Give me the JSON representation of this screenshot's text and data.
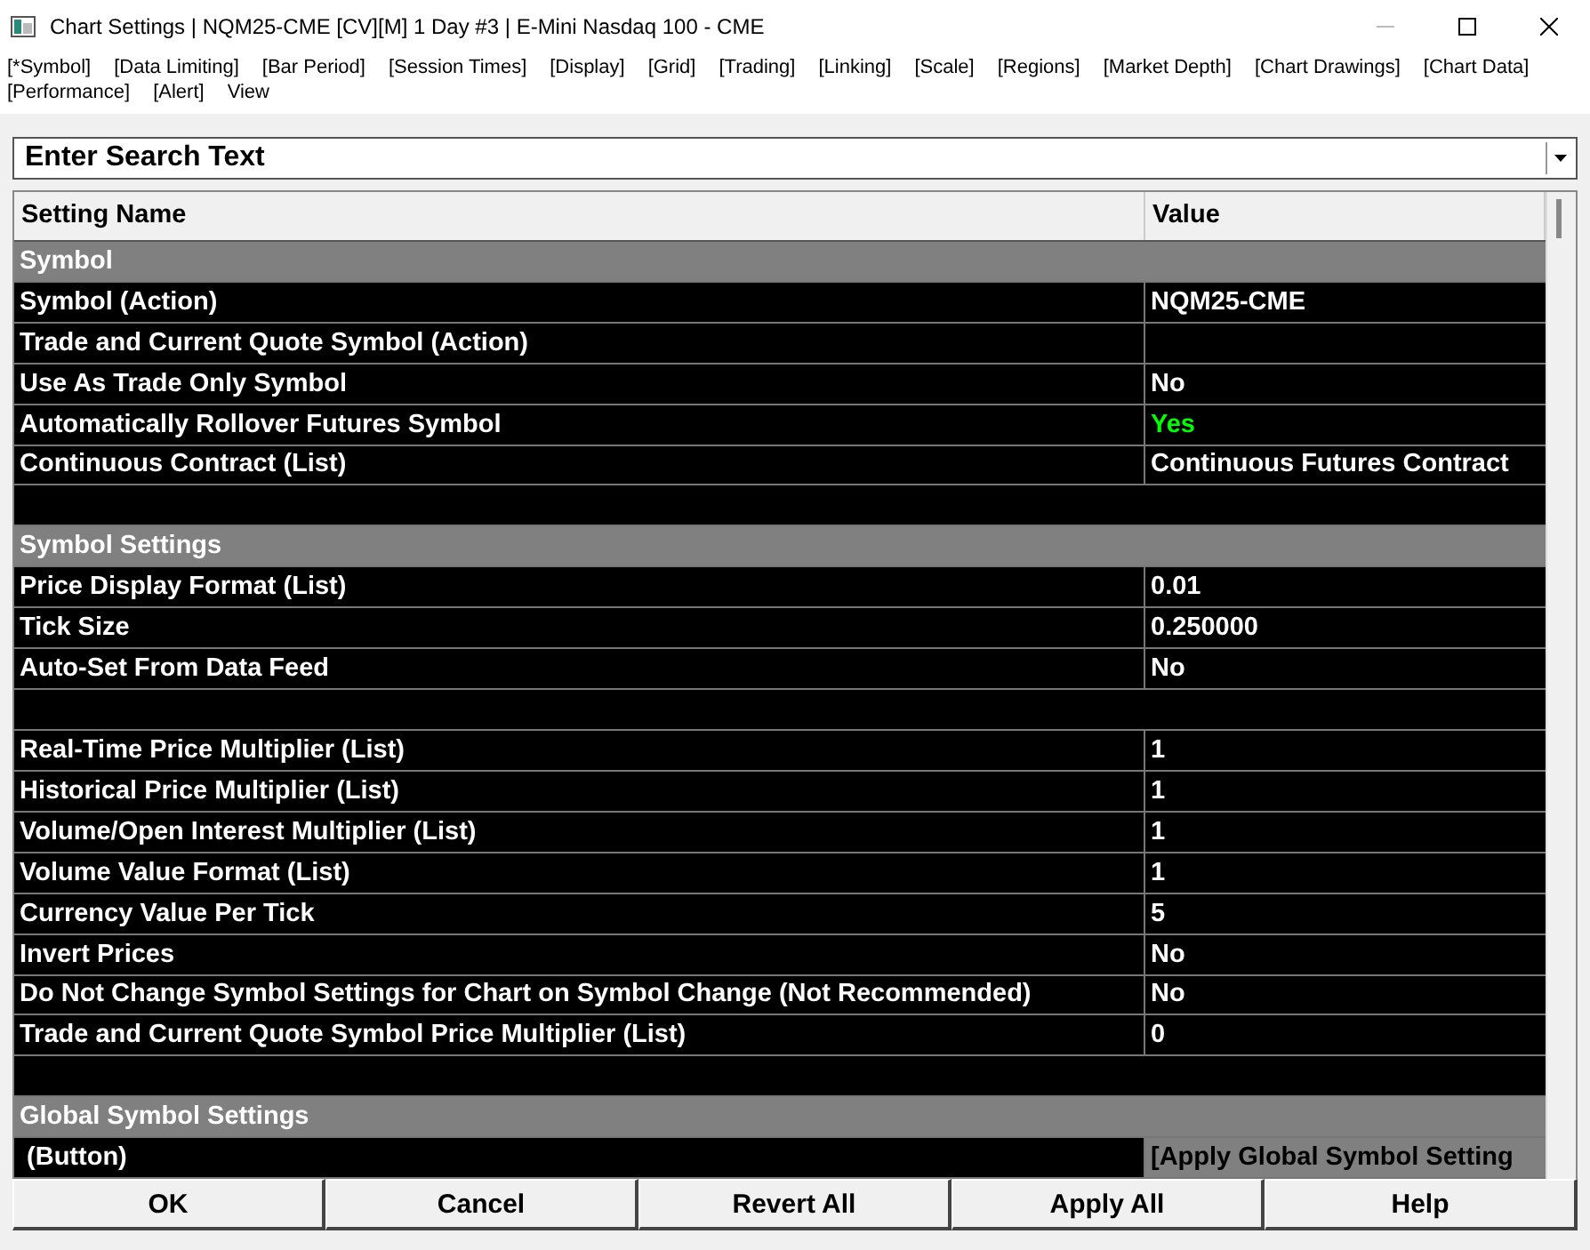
{
  "window": {
    "title": "Chart Settings | NQM25-CME [CV][M]  1 Day  #3 | E-Mini Nasdaq 100 - CME"
  },
  "tabs": [
    "[*Symbol]",
    "[Data Limiting]",
    "[Bar Period]",
    "[Session Times]",
    "[Display]",
    "[Grid]",
    "[Trading]",
    "[Linking]",
    "[Scale]",
    "[Regions]",
    "[Market Depth]",
    "[Chart Drawings]",
    "[Chart Data]",
    "[Performance]",
    "[Alert]",
    "View"
  ],
  "search": {
    "placeholder": "Enter Search Text"
  },
  "table": {
    "columns": [
      "Setting Name",
      "Value"
    ],
    "rows": [
      {
        "kind": "section",
        "name": "Symbol"
      },
      {
        "kind": "setting",
        "name": "Symbol (Action)",
        "value": "NQM25-CME"
      },
      {
        "kind": "setting",
        "name": "Trade and Current Quote Symbol (Action)"
      },
      {
        "kind": "setting",
        "name": "Use As Trade Only Symbol",
        "value": "No"
      },
      {
        "kind": "setting",
        "name": "Automatically Rollover Futures Symbol",
        "value": "Yes",
        "color": "#00ff00"
      },
      {
        "kind": "setting",
        "name": "Continuous Contract (List)",
        "value": "Continuous Futures Contract"
      },
      {
        "kind": "blank"
      },
      {
        "kind": "section",
        "name": "Symbol Settings"
      },
      {
        "kind": "setting",
        "name": "Price Display Format (List)",
        "value": "0.01"
      },
      {
        "kind": "setting",
        "name": "Tick Size",
        "value": "0.250000"
      },
      {
        "kind": "setting",
        "name": "Auto-Set From Data Feed",
        "value": "No"
      },
      {
        "kind": "blank"
      },
      {
        "kind": "setting",
        "name": "Real-Time Price Multiplier (List)",
        "value": "1"
      },
      {
        "kind": "setting",
        "name": "Historical Price Multiplier (List)",
        "value": "1"
      },
      {
        "kind": "setting",
        "name": "Volume/Open Interest Multiplier (List)",
        "value": "1"
      },
      {
        "kind": "setting",
        "name": "Volume Value Format (List)",
        "value": "1"
      },
      {
        "kind": "setting",
        "name": "Currency Value Per Tick",
        "value": "5"
      },
      {
        "kind": "setting",
        "name": "Invert Prices",
        "value": "No"
      },
      {
        "kind": "setting",
        "name": "Do Not Change Symbol Settings for Chart on Symbol Change (Not Recommended)",
        "value": "No"
      },
      {
        "kind": "setting",
        "name": "Trade and Current Quote Symbol Price Multiplier (List)",
        "value": "0"
      },
      {
        "kind": "blank"
      },
      {
        "kind": "section",
        "name": "Global Symbol Settings"
      },
      {
        "kind": "button",
        "name": " (Button)",
        "value": "[Apply Global Symbol Setting"
      }
    ]
  },
  "buttons": [
    "OK",
    "Cancel",
    "Revert All",
    "Apply All",
    "Help"
  ]
}
